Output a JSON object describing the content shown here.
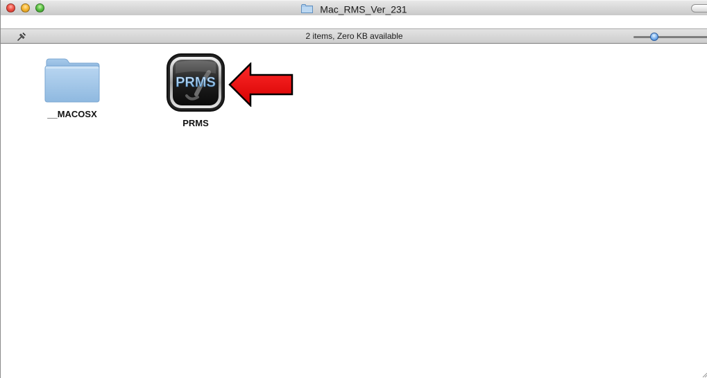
{
  "window": {
    "title": "Mac_RMS_Ver_231",
    "title_icon": "folder-icon"
  },
  "statusbar": {
    "text": "2 items, Zero KB available",
    "left_icon": "pin-icon",
    "icon_size_slider": "small"
  },
  "items": [
    {
      "label": "__MACOSX",
      "icon": "folder-icon"
    },
    {
      "label": "PRMS",
      "icon": "prms-app-icon",
      "icon_text": "PRMS"
    }
  ],
  "annotation": {
    "icon": "red-arrow-icon",
    "color": "#e00000"
  },
  "colors": {
    "folder_blue": "#9cc3e6",
    "close": "#f0564a",
    "minimize": "#f7b935",
    "zoom": "#5fc34a"
  }
}
